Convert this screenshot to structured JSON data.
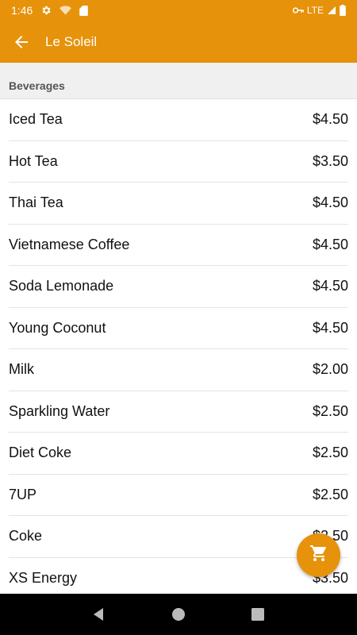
{
  "status_bar": {
    "time": "1:46",
    "network": "LTE",
    "icons": [
      "settings-icon",
      "wifi-icon",
      "sd-card-icon",
      "key-icon",
      "signal-icon",
      "battery-icon"
    ]
  },
  "app_bar": {
    "title": "Le Soleil",
    "back_icon": "arrow-back-icon"
  },
  "section": {
    "title": "Beverages"
  },
  "items": [
    {
      "name": "Iced Tea",
      "price": "$4.50"
    },
    {
      "name": "Hot Tea",
      "price": "$3.50"
    },
    {
      "name": "Thai Tea",
      "price": "$4.50"
    },
    {
      "name": "Vietnamese Coffee",
      "price": "$4.50"
    },
    {
      "name": "Soda Lemonade",
      "price": "$4.50"
    },
    {
      "name": "Young Coconut",
      "price": "$4.50"
    },
    {
      "name": "Milk",
      "price": "$2.00"
    },
    {
      "name": "Sparkling Water",
      "price": "$2.50"
    },
    {
      "name": "Diet Coke",
      "price": "$2.50"
    },
    {
      "name": "7UP",
      "price": "$2.50"
    },
    {
      "name": "Coke",
      "price": "$2.50"
    },
    {
      "name": "XS Energy",
      "price": "$3.50"
    }
  ],
  "fab": {
    "icon": "shopping-cart-icon"
  },
  "colors": {
    "accent": "#e6920a",
    "nav_bar": "#000000"
  }
}
